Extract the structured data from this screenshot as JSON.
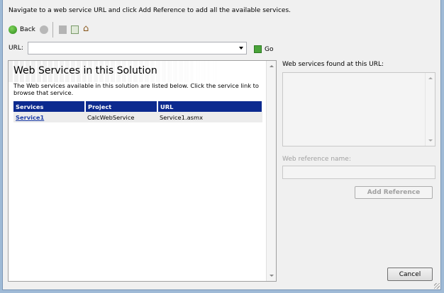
{
  "instruction": "Navigate to a web service URL and click Add Reference to add all the available services.",
  "toolbar": {
    "back_label": "Back"
  },
  "url": {
    "label": "URL:",
    "value": "",
    "go_label": "Go"
  },
  "browser": {
    "title": "Web Services in this Solution",
    "description": "The Web services available in this solution are listed below. Click the service link to browse that service.",
    "columns": [
      "Services",
      "Project",
      "URL"
    ],
    "rows": [
      {
        "service": "Service1",
        "project": "CalcWebService",
        "url": "Service1.asmx"
      }
    ]
  },
  "right": {
    "found_label": "Web services found at this URL:",
    "ref_name_label": "Web reference name:",
    "ref_name_value": "",
    "add_reference": "Add Reference"
  },
  "cancel": "Cancel"
}
